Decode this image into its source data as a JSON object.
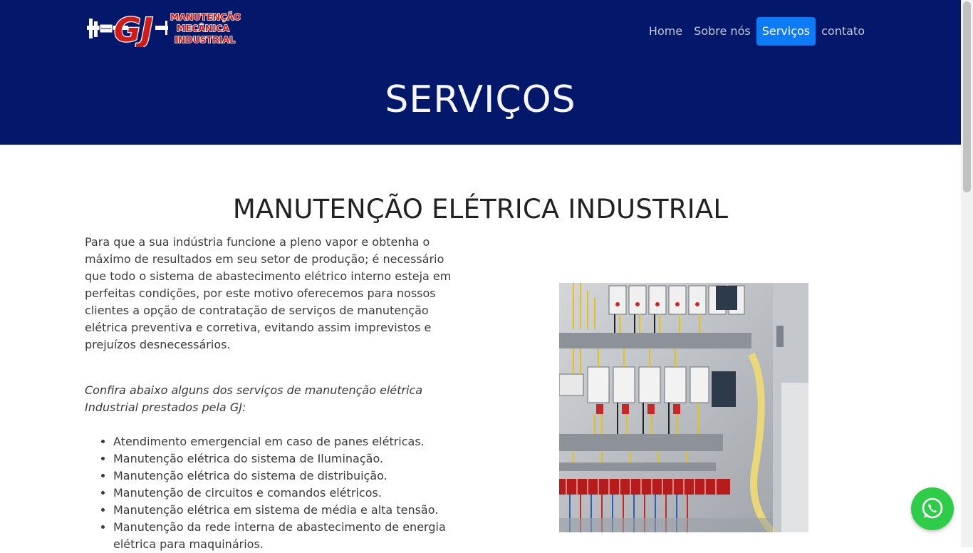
{
  "brand": {
    "logo_letters": "GJ",
    "logo_text": [
      "MANUTENÇÃO",
      "MECÂNICA",
      "INDUSTRIAL"
    ]
  },
  "nav": {
    "items": [
      {
        "label": "Home"
      },
      {
        "label": "Sobre nós"
      },
      {
        "label": "Serviços",
        "active": true
      },
      {
        "label": "contato"
      }
    ]
  },
  "hero": {
    "title": "SERVIÇOS"
  },
  "section": {
    "title": "MANUTENÇÃO ELÉTRICA INDUSTRIAL",
    "intro": "Para que a sua indústria funcione a pleno vapor e obtenha o máximo de resultados em seu setor de produção; é necessário que todo o sistema de abastecimento elétrico interno esteja em perfeitas condições, por este motivo oferecemos para nossos clientes a opção de contratação de serviços de manutenção elétrica preventiva e corretiva, evitando assim imprevistos e prejuízos desnecessários.",
    "confira": "Confira abaixo alguns dos serviços de manutenção elétrica Industrial prestados pela GJ:",
    "services": [
      "Atendimento emergencial em caso de panes elétricas.",
      "Manutenção elétrica do sistema de Iluminação.",
      "Manutenção elétrica do sistema de distribuição.",
      "Manutenção de circuitos e comandos elétricos.",
      "Manutenção elétrica em sistema de média e alta tensão.",
      "Manutenção da rede interna de abastecimento de energia elétrica para maquinários."
    ]
  },
  "icons": {
    "whatsapp": "whatsapp-icon"
  },
  "colors": {
    "header_bg": "#03176b",
    "nav_active_bg": "#0d7bf5",
    "whatsapp": "#2ecc48",
    "logo_red": "#d01b1b"
  }
}
